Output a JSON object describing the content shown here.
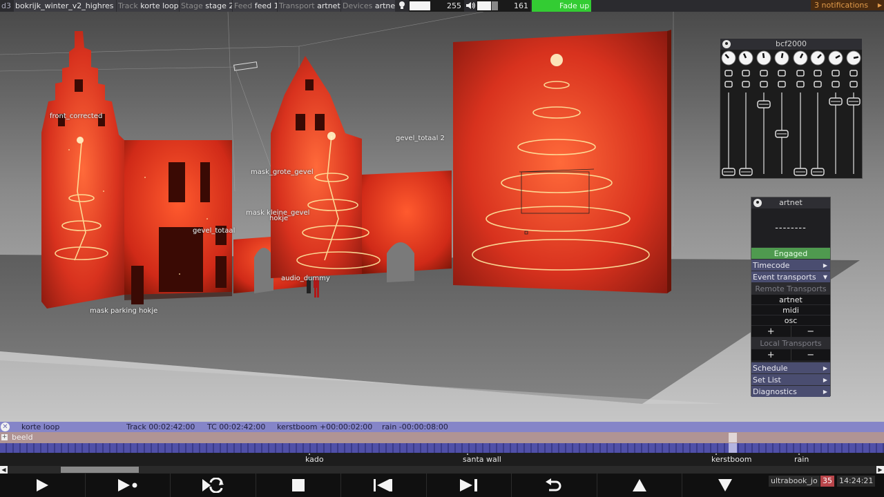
{
  "app": {
    "logo": "d3",
    "project": "bokrijk_winter_v2_highres"
  },
  "topbar": {
    "track_label": "Track",
    "track_value": "korte loop",
    "stage_label": "Stage",
    "stage_value": "stage 2",
    "feed_label": "Feed",
    "feed_value": "feed 1",
    "transport_label": "Transport",
    "transport_value": "artnet",
    "devices_label": "Devices",
    "devices_value": "artnet",
    "brightness_value": "255",
    "volume_value": "161",
    "fade_label": "Fade up",
    "fade_color": "#33cc33"
  },
  "notifications": {
    "label": "3 notifications"
  },
  "viewport": {
    "labels": {
      "front_corrected": "front_corrected",
      "gevel_totaal_2": "gevel_totaal 2",
      "mask_grote_gevel": "mask_grote_gevel",
      "mask_kleine_gevel": "mask kleine_gevel",
      "hokje": "hokje",
      "gevel_totaal": "gevel_totaal",
      "audio_dummy": "audio_dummy",
      "mask_parking_hokje": "mask parking hokje"
    }
  },
  "bcf_panel": {
    "title": "bcf2000",
    "fader_levels": [
      0.0,
      0.0,
      0.96,
      0.54,
      0.0,
      0.0,
      1.0,
      1.0
    ]
  },
  "artnet_panel": {
    "title": "artnet",
    "value": "--------",
    "engaged_label": "Engaged",
    "engaged_color": "#4f9a4f",
    "timecode_label": "Timecode",
    "event_transports_label": "Event transports",
    "remote_transports_label": "Remote Transports",
    "remote_items": [
      "artnet",
      "midi",
      "osc"
    ],
    "local_transports_label": "Local Transports",
    "add_symbol": "+",
    "remove_symbol": "−",
    "schedule_label": "Schedule",
    "set_list_label": "Set List",
    "diagnostics_label": "Diagnostics"
  },
  "timeline": {
    "track_name": "korte loop",
    "track_time": "Track 00:02:42:00",
    "tc_time": "TC 00:02:42:00",
    "cue1": "kerstboom +00:00:02:00",
    "cue2": "rain -00:00:08:00",
    "layer_name": "beeld",
    "sections": {
      "kado": "kado",
      "santa_wall": "santa wall",
      "kerstboom": "kerstboom",
      "rain": "rain"
    }
  },
  "status": {
    "user": "ultrabook_jo",
    "fps": "35",
    "clock": "14:24:21"
  },
  "icons": {
    "play": "play-icon",
    "play_section": "play-to-end-of-section-icon",
    "loop": "loop-section-icon",
    "stop": "stop-icon",
    "prev": "previous-section-icon",
    "next": "next-section-icon",
    "return": "return-to-start-icon",
    "up": "up-arrow-icon",
    "down": "down-arrow-icon"
  }
}
